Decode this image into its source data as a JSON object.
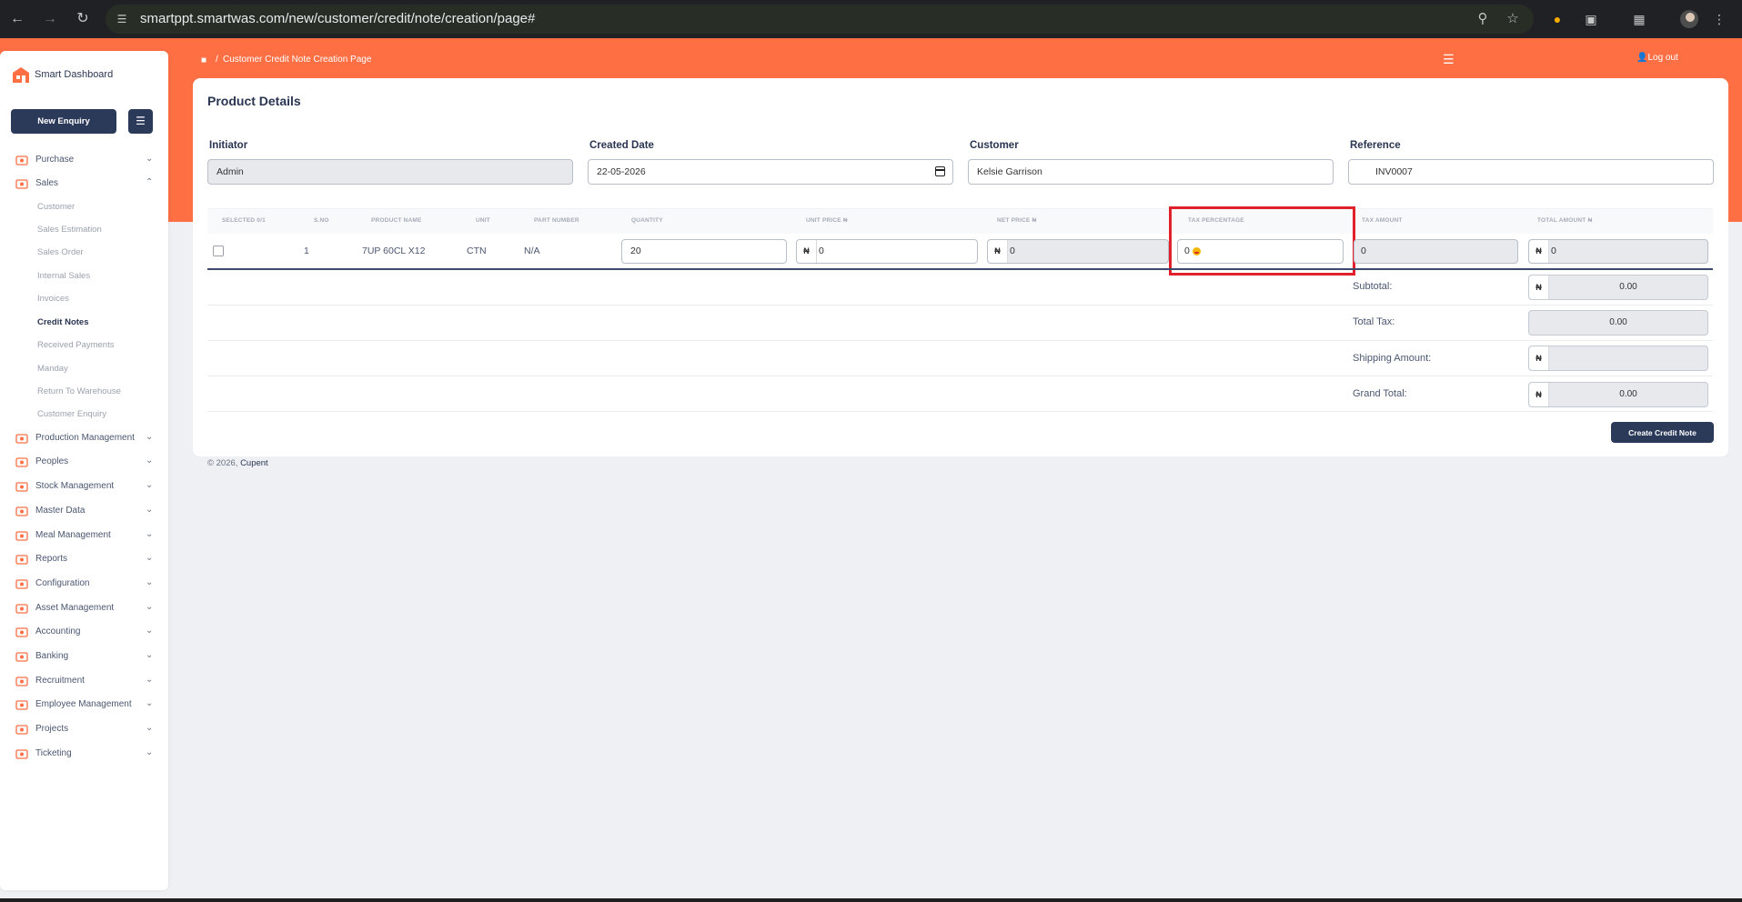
{
  "browser": {
    "url": "smartppt.smartwas.com/new/customer/credit/note/creation/page#"
  },
  "app": {
    "brand": "Smart Dashboard",
    "new_enquiry_label": "New Enquiry",
    "breadcrumb": "Customer Credit Note Creation Page",
    "logout_label": "Log out",
    "accent_color": "#ff6f44",
    "primary_color": "#2c3a5a"
  },
  "sidebar": {
    "items": [
      {
        "label": "Purchase",
        "icon": "cart-icon"
      },
      {
        "label": "Sales",
        "icon": "bag-icon"
      },
      {
        "label": "Production Management",
        "icon": "factory-icon"
      },
      {
        "label": "Peoples",
        "icon": "people-icon"
      },
      {
        "label": "Stock Management",
        "icon": "warehouse-icon"
      },
      {
        "label": "Master Data",
        "icon": "database-icon"
      },
      {
        "label": "Meal Management",
        "icon": "meal-icon"
      },
      {
        "label": "Reports",
        "icon": "report-icon"
      },
      {
        "label": "Configuration",
        "icon": "config-icon"
      },
      {
        "label": "Asset Management",
        "icon": "asset-icon"
      },
      {
        "label": "Accounting",
        "icon": "accounting-icon"
      },
      {
        "label": "Banking",
        "icon": "bank-icon"
      },
      {
        "label": "Recruitment",
        "icon": "recruitment-icon"
      },
      {
        "label": "Employee Management",
        "icon": "employee-icon"
      },
      {
        "label": "Projects",
        "icon": "projects-icon"
      },
      {
        "label": "Ticketing",
        "icon": "ticket-icon"
      }
    ],
    "sales_sub": [
      "Customer",
      "Sales Estimation",
      "Sales Order",
      "Internal Sales",
      "Invoices",
      "Credit Notes",
      "Received Payments",
      "Manday",
      "Return To Warehouse",
      "Customer Enquiry"
    ],
    "active_sub": "Credit Notes"
  },
  "form": {
    "title": "Product Details",
    "initiator": {
      "label": "Initiator",
      "value": "Admin"
    },
    "created_date": {
      "label": "Created Date",
      "value": "22-05-2026"
    },
    "customer": {
      "label": "Customer",
      "value": "Kelsie Garrison"
    },
    "reference": {
      "label": "Reference",
      "value": "INV0007"
    }
  },
  "table": {
    "headers": [
      "SELECTED 0/1",
      "S.NO",
      "PRODUCT NAME",
      "UNIT",
      "PART NUMBER",
      "QUANTITY",
      "UNIT PRICE ₦",
      "NET PRICE ₦",
      "TAX PERCENTAGE",
      "TAX AMOUNT",
      "TOTAL AMOUNT ₦"
    ],
    "row": {
      "sno": "1",
      "product_name": "7UP 60CL X12",
      "unit": "CTN",
      "part_number": "N/A",
      "quantity": "20",
      "unit_price": "0",
      "net_price": "0",
      "tax_percentage": "0",
      "tax_amount": "0",
      "total_amount": "0"
    }
  },
  "currency_symbol": "₦",
  "summary": {
    "subtotal_label": "Subtotal:",
    "subtotal": "0.00",
    "total_tax_label": "Total Tax:",
    "total_tax": "0.00",
    "shipping_label": "Shipping Amount:",
    "shipping": "",
    "grand_total_label": "Grand Total:",
    "grand_total": "0.00"
  },
  "actions": {
    "create_label": "Create Credit Note"
  },
  "footer": {
    "copyright": "© 2026,",
    "company": "Cupent"
  }
}
